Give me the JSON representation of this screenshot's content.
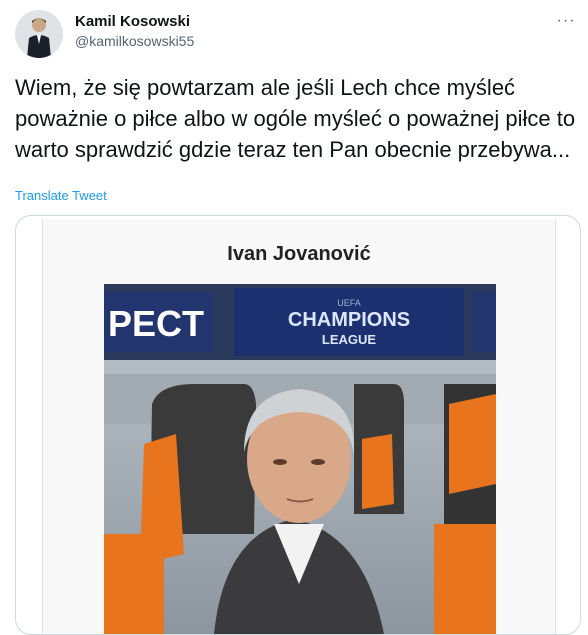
{
  "tweet": {
    "author_name": "Kamil Kosowski",
    "author_handle": "@kamilkosowski55",
    "more_label": "···",
    "text": "Wiem, że się powtarzam ale jeśli Lech chce myśleć poważnie o piłce albo w ogóle myśleć o poważnej piłce to warto sprawdzić gdzie teraz ten Pan obecnie przebywa...",
    "translate_label": "Translate Tweet"
  },
  "card": {
    "title": "Ivan Jovanović",
    "banner_left": "PECT",
    "banner_center_line1": "CHAMPIONS",
    "banner_center_line2": "LEAGUE",
    "banner_small": "UEFA"
  },
  "colors": {
    "link": "#1d9bf0",
    "secondary_text": "#536471",
    "border": "#cfd9de",
    "banner_blue": "#1c2f6e",
    "seat_orange": "#e8741e"
  }
}
